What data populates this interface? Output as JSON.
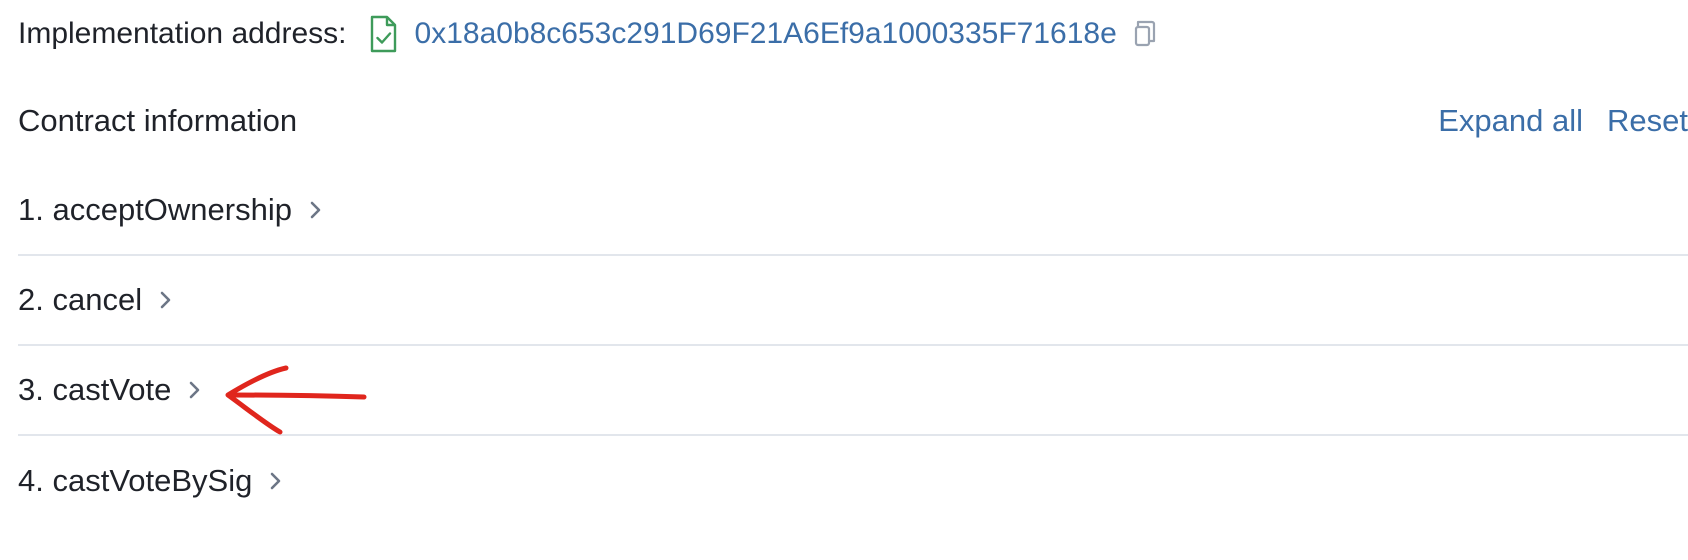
{
  "implementation": {
    "label": "Implementation address:",
    "address": "0x18a0b8c653c291D69F21A6Ef9a1000335F71618e",
    "file_icon": "file-check-icon",
    "copy_icon": "copy-icon"
  },
  "contract": {
    "title": "Contract information",
    "expand_all": "Expand all",
    "reset": "Reset"
  },
  "methods": [
    {
      "label": "1. acceptOwnership"
    },
    {
      "label": "2. cancel"
    },
    {
      "label": "3. castVote"
    },
    {
      "label": "4. castVoteBySig"
    }
  ],
  "colors": {
    "link": "#3b6ea8",
    "text": "#1f2229",
    "verified_icon": "#3e9b5a",
    "chevron": "#6c7686",
    "divider": "#e2e6ec",
    "annotation": "#e0261d"
  }
}
